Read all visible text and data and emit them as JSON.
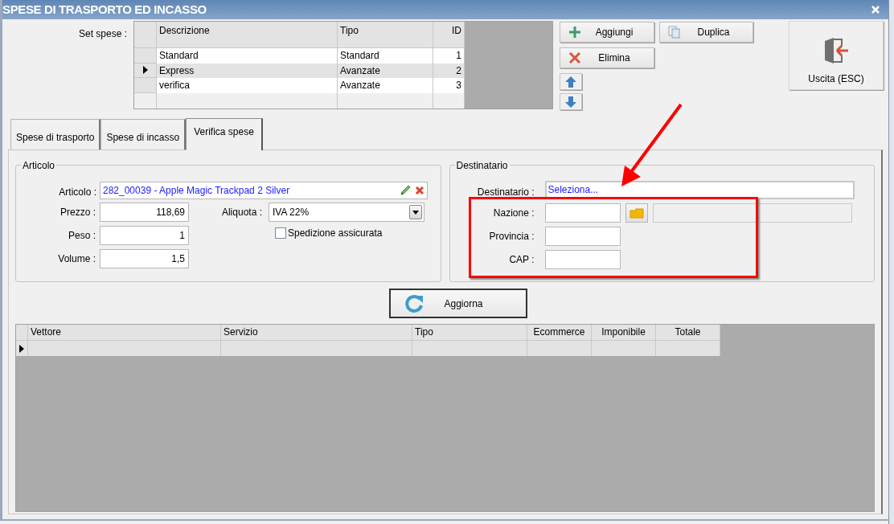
{
  "window": {
    "title": "SPESE DI TRASPORTO ED INCASSO"
  },
  "set_spese": {
    "label": "Set spese :",
    "columns": [
      "Descrizione",
      "Tipo",
      "ID"
    ],
    "rows": [
      {
        "descrizione": "Standard",
        "tipo": "Standard",
        "id": "1",
        "selected": false
      },
      {
        "descrizione": "Express",
        "tipo": "Avanzate",
        "id": "2",
        "selected": true
      },
      {
        "descrizione": "verifica",
        "tipo": "Avanzate",
        "id": "3",
        "selected": false
      }
    ]
  },
  "buttons": [
    {
      "kind": "add",
      "label": "Aggiungi"
    },
    {
      "kind": "duplicate",
      "label": "Duplica"
    },
    {
      "kind": "delete",
      "label": "Elimina"
    }
  ],
  "exit_button": {
    "label": "Uscita (ESC)"
  },
  "tabs": [
    {
      "label": "Spese di trasporto",
      "selected": false
    },
    {
      "label": "Spese di incasso",
      "selected": false
    },
    {
      "label": "Verifica spese",
      "selected": true
    }
  ],
  "articolo": {
    "title": "Articolo",
    "articolo_label": "Articolo :",
    "articolo_value": "282_00039 - Apple Magic Trackpad 2 Silver",
    "fields": [
      {
        "label": "Prezzo :",
        "value": "118,69"
      },
      {
        "label": "Peso :",
        "value": "1"
      },
      {
        "label": "Volume :",
        "value": "1,5"
      }
    ],
    "aliquota_label": "Aliquota :",
    "aliquota_value": "IVA 22%",
    "assicurata": {
      "label": "Spedizione assicurata",
      "checked": false
    }
  },
  "destinatario": {
    "title": "Destinatario",
    "destinatario_label": "Destinatario :",
    "destinatario_value": "Seleziona...",
    "fields": [
      {
        "label": "Nazione :"
      },
      {
        "label": "Provincia :"
      },
      {
        "label": "CAP :"
      }
    ]
  },
  "refresh_button": {
    "label": "Aggiorna"
  },
  "results": {
    "columns": [
      "Vettore",
      "Servizio",
      "Tipo",
      "Ecommerce",
      "Imponibile",
      "Totale"
    ],
    "rows": [
      {
        "selected": true
      }
    ]
  }
}
